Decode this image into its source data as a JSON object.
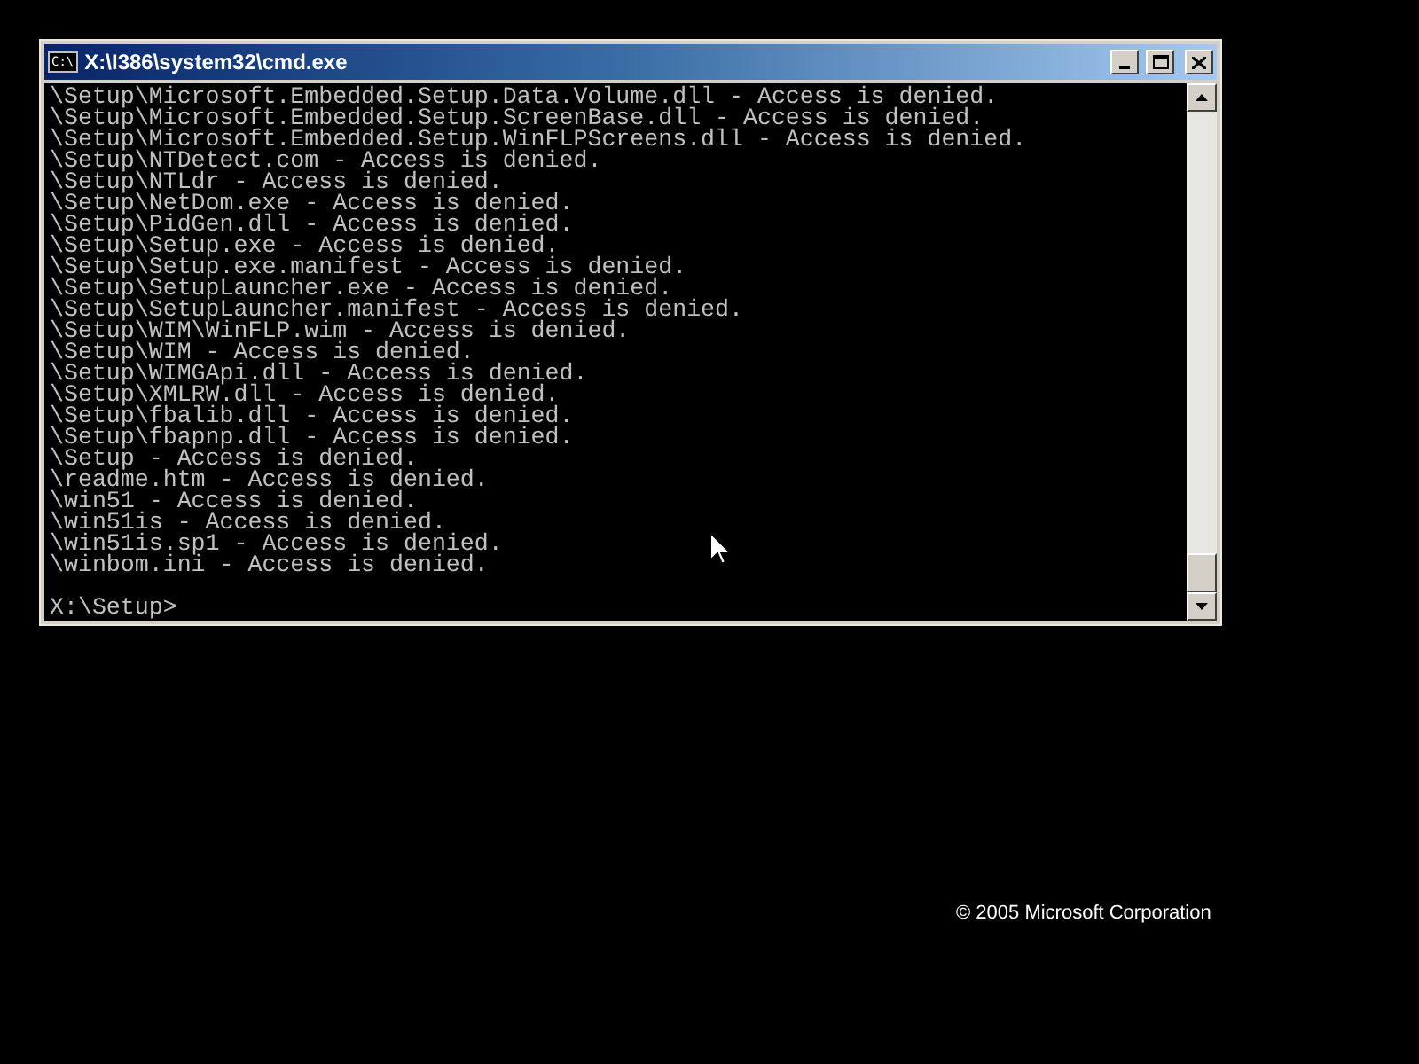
{
  "window": {
    "title": "X:\\I386\\system32\\cmd.exe",
    "icon_text": "C:\\"
  },
  "console": {
    "lines": [
      "\\Setup\\Microsoft.Embedded.Setup.Data.Volume.dll - Access is denied.",
      "\\Setup\\Microsoft.Embedded.Setup.ScreenBase.dll - Access is denied.",
      "\\Setup\\Microsoft.Embedded.Setup.WinFLPScreens.dll - Access is denied.",
      "\\Setup\\NTDetect.com - Access is denied.",
      "\\Setup\\NTLdr - Access is denied.",
      "\\Setup\\NetDom.exe - Access is denied.",
      "\\Setup\\PidGen.dll - Access is denied.",
      "\\Setup\\Setup.exe - Access is denied.",
      "\\Setup\\Setup.exe.manifest - Access is denied.",
      "\\Setup\\SetupLauncher.exe - Access is denied.",
      "\\Setup\\SetupLauncher.manifest - Access is denied.",
      "\\Setup\\WIM\\WinFLP.wim - Access is denied.",
      "\\Setup\\WIM - Access is denied.",
      "\\Setup\\WIMGApi.dll - Access is denied.",
      "\\Setup\\XMLRW.dll - Access is denied.",
      "\\Setup\\fbalib.dll - Access is denied.",
      "\\Setup\\fbapnp.dll - Access is denied.",
      "\\Setup - Access is denied.",
      "\\readme.htm - Access is denied.",
      "\\win51 - Access is denied.",
      "\\win51is - Access is denied.",
      "\\win51is.sp1 - Access is denied.",
      "\\winbom.ini - Access is denied."
    ],
    "prompt": "X:\\Setup>"
  },
  "footer": {
    "copyright": "© 2005 Microsoft Corporation"
  }
}
